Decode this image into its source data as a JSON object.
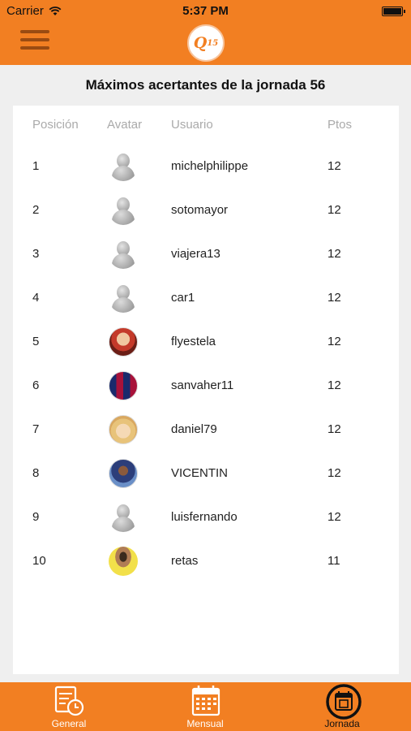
{
  "status_bar": {
    "carrier": "Carrier",
    "time": "5:37 PM"
  },
  "header": {
    "logo_text": "Q",
    "logo_sup": "15"
  },
  "title": "Máximos acertantes de la jornada 56",
  "table": {
    "columns": [
      "Posición",
      "Avatar",
      "Usuario",
      "Ptos"
    ],
    "rows": [
      {
        "pos": "1",
        "user": "michelphilippe",
        "pts": "12",
        "avatar": "default-avatar"
      },
      {
        "pos": "2",
        "user": "sotomayor",
        "pts": "12",
        "avatar": "default-avatar"
      },
      {
        "pos": "3",
        "user": "viajera13",
        "pts": "12",
        "avatar": "default-avatar"
      },
      {
        "pos": "4",
        "user": "car1",
        "pts": "12",
        "avatar": "default-avatar"
      },
      {
        "pos": "5",
        "user": "flyestela",
        "pts": "12",
        "avatar": "photo"
      },
      {
        "pos": "6",
        "user": "sanvaher11",
        "pts": "12",
        "avatar": "photo"
      },
      {
        "pos": "7",
        "user": "daniel79",
        "pts": "12",
        "avatar": "photo"
      },
      {
        "pos": "8",
        "user": "VICENTIN",
        "pts": "12",
        "avatar": "photo"
      },
      {
        "pos": "9",
        "user": "luisfernando",
        "pts": "12",
        "avatar": "default-avatar"
      },
      {
        "pos": "10",
        "user": "retas",
        "pts": "11",
        "avatar": "photo"
      }
    ]
  },
  "tabs": [
    {
      "label": "General",
      "icon": "clipboard-clock-icon",
      "active": false
    },
    {
      "label": "Mensual",
      "icon": "calendar-icon",
      "active": false
    },
    {
      "label": "Jornada",
      "icon": "calendar-day-icon",
      "active": true
    }
  ],
  "colors": {
    "accent": "#f27f22",
    "accent_dark": "#9a4b12",
    "header_text": "#aaaaaa"
  }
}
